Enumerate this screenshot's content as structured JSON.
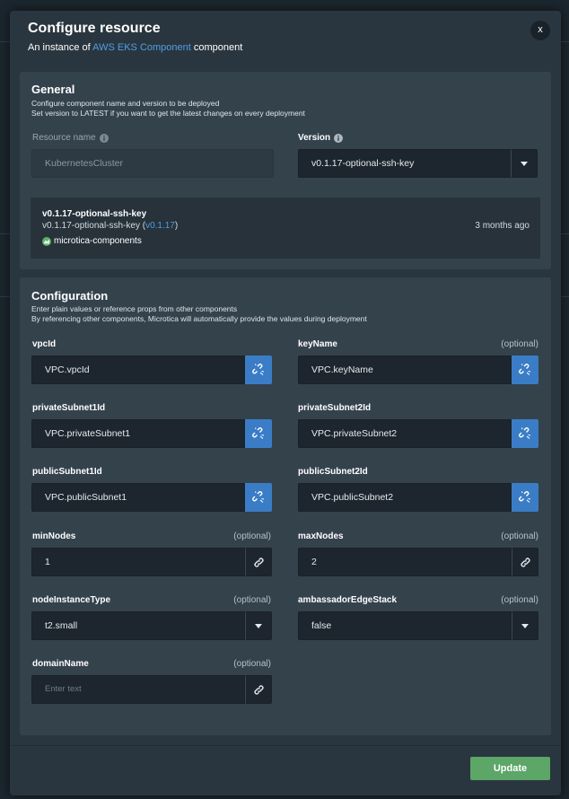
{
  "modal": {
    "title": "Configure resource",
    "subtitle_prefix": "An instance of",
    "subtitle_link": "AWS EKS Component",
    "subtitle_suffix": "component",
    "close_label": "x"
  },
  "general": {
    "title": "General",
    "desc_line1": "Configure component name and version to be deployed",
    "desc_line2": "Set version to LATEST if you want to get the latest changes on every deployment",
    "resource_name_label": "Resource name",
    "resource_name_value": "KubernetesCluster",
    "version_label": "Version",
    "version_value": "v0.1.17-optional-ssh-key",
    "version_info": {
      "title": "v0.1.17-optional-ssh-key",
      "line_prefix": "v0.1.17-optional-ssh-key (",
      "line_link": "v0.1.17",
      "line_suffix": ")",
      "owner": "microtica-components",
      "time": "3 months ago"
    }
  },
  "configuration": {
    "title": "Configuration",
    "desc_line1": "Enter plain values or reference props from other components",
    "desc_line2": "By referencing other components, Microtica will automatically provide the values during deployment",
    "optional_label": "(optional)",
    "fields": {
      "vpcId": {
        "label": "vpcId",
        "value": "VPC.vpcId"
      },
      "keyName": {
        "label": "keyName",
        "value": "VPC.keyName"
      },
      "privateSubnet1Id": {
        "label": "privateSubnet1Id",
        "value": "VPC.privateSubnet1"
      },
      "privateSubnet2Id": {
        "label": "privateSubnet2Id",
        "value": "VPC.privateSubnet2"
      },
      "publicSubnet1Id": {
        "label": "publicSubnet1Id",
        "value": "VPC.publicSubnet1"
      },
      "publicSubnet2Id": {
        "label": "publicSubnet2Id",
        "value": "VPC.publicSubnet2"
      },
      "minNodes": {
        "label": "minNodes",
        "value": "1"
      },
      "maxNodes": {
        "label": "maxNodes",
        "value": "2"
      },
      "nodeInstanceType": {
        "label": "nodeInstanceType",
        "value": "t2.small"
      },
      "ambassadorEdgeStack": {
        "label": "ambassadorEdgeStack",
        "value": "false"
      },
      "domainName": {
        "label": "domainName",
        "placeholder": "Enter text"
      }
    }
  },
  "footer": {
    "update_label": "Update"
  },
  "colors": {
    "accent_blue": "#3a7dc6",
    "link_blue": "#4f9ee6",
    "update_green": "#5ca667"
  }
}
